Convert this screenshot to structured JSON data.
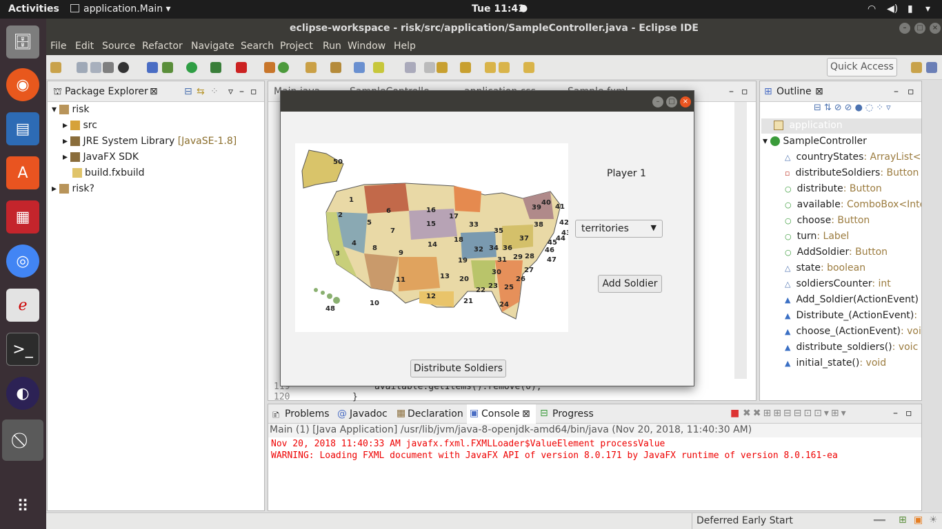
{
  "topbar": {
    "activities": "Activities",
    "app": "application.Main",
    "clock": "Tue 11:41"
  },
  "window": {
    "title": "eclipse-workspace - risk/src/application/SampleController.java - Eclipse IDE"
  },
  "menu": [
    "File",
    "Edit",
    "Source",
    "Refactor",
    "Navigate",
    "Search",
    "Project",
    "Run",
    "Window",
    "Help"
  ],
  "toolbar": {
    "quick_access": "Quick Access"
  },
  "package_explorer": {
    "title": "Package Explorer",
    "items": [
      {
        "label": "risk"
      },
      {
        "label": "src"
      },
      {
        "label": "JRE System Library",
        "decor": "[JavaSE-1.8]"
      },
      {
        "label": "JavaFX SDK"
      },
      {
        "label": "build.fxbuild"
      },
      {
        "label": "risk?"
      }
    ]
  },
  "editor": {
    "tabs": [
      "Main.java",
      "SampleControlle",
      "application.css",
      "Sample.fxml"
    ],
    "line_119": "119",
    "line_120": "120",
    "code_119": "available.getItems().remove(0);",
    "code_120": "}"
  },
  "outline": {
    "title": "Outline",
    "package": "application",
    "class": "SampleController",
    "members": [
      {
        "name": "countryStates",
        "type": "ArrayList<"
      },
      {
        "name": "distributeSoldiers",
        "type": "Button"
      },
      {
        "name": "distribute",
        "type": "Button"
      },
      {
        "name": "available",
        "type": "ComboBox<Inte"
      },
      {
        "name": "choose",
        "type": "Button"
      },
      {
        "name": "turn",
        "type": "Label"
      },
      {
        "name": "AddSoldier",
        "type": "Button"
      },
      {
        "name": "state",
        "type": "boolean"
      },
      {
        "name": "soldiersCounter",
        "type": "int"
      },
      {
        "name": "Add_Soldier(ActionEvent)",
        "type": ""
      },
      {
        "name": "Distribute_(ActionEvent)",
        "type": ":"
      },
      {
        "name": "choose_(ActionEvent)",
        "type": "voi"
      },
      {
        "name": "distribute_soldiers()",
        "type": "voic"
      },
      {
        "name": "initial_state()",
        "type": "void"
      }
    ]
  },
  "bottom": {
    "tabs": [
      "Problems",
      "Javadoc",
      "Declaration",
      "Console",
      "Progress"
    ],
    "console_header": "Main (1) [Java Application] /usr/lib/jvm/java-8-openjdk-amd64/bin/java (Nov 20, 2018, 11:40:30 AM)",
    "lines": [
      "Nov 20, 2018 11:40:33 AM javafx.fxml.FXMLLoader$ValueElement processValue",
      "WARNING: Loading FXML document with JavaFX API of version 8.0.171 by JavaFX runtime of version 8.0.161-ea"
    ]
  },
  "dialog": {
    "player": "Player 1",
    "combo": "territories",
    "add": "Add Soldier",
    "distribute": "Distribute Soldiers",
    "states": [
      "50",
      "1",
      "2",
      "3",
      "4",
      "5",
      "6",
      "7",
      "8",
      "9",
      "10",
      "11",
      "12",
      "13",
      "14",
      "15",
      "16",
      "17",
      "18",
      "19",
      "20",
      "21",
      "22",
      "23",
      "24",
      "25",
      "26",
      "27",
      "28",
      "29",
      "30",
      "31",
      "32",
      "33",
      "34",
      "35",
      "36",
      "37",
      "38",
      "39",
      "40",
      "41",
      "42",
      "43",
      "44",
      "45",
      "46",
      "47",
      "48",
      "49"
    ]
  },
  "status": {
    "text": "Deferred Early Start"
  }
}
